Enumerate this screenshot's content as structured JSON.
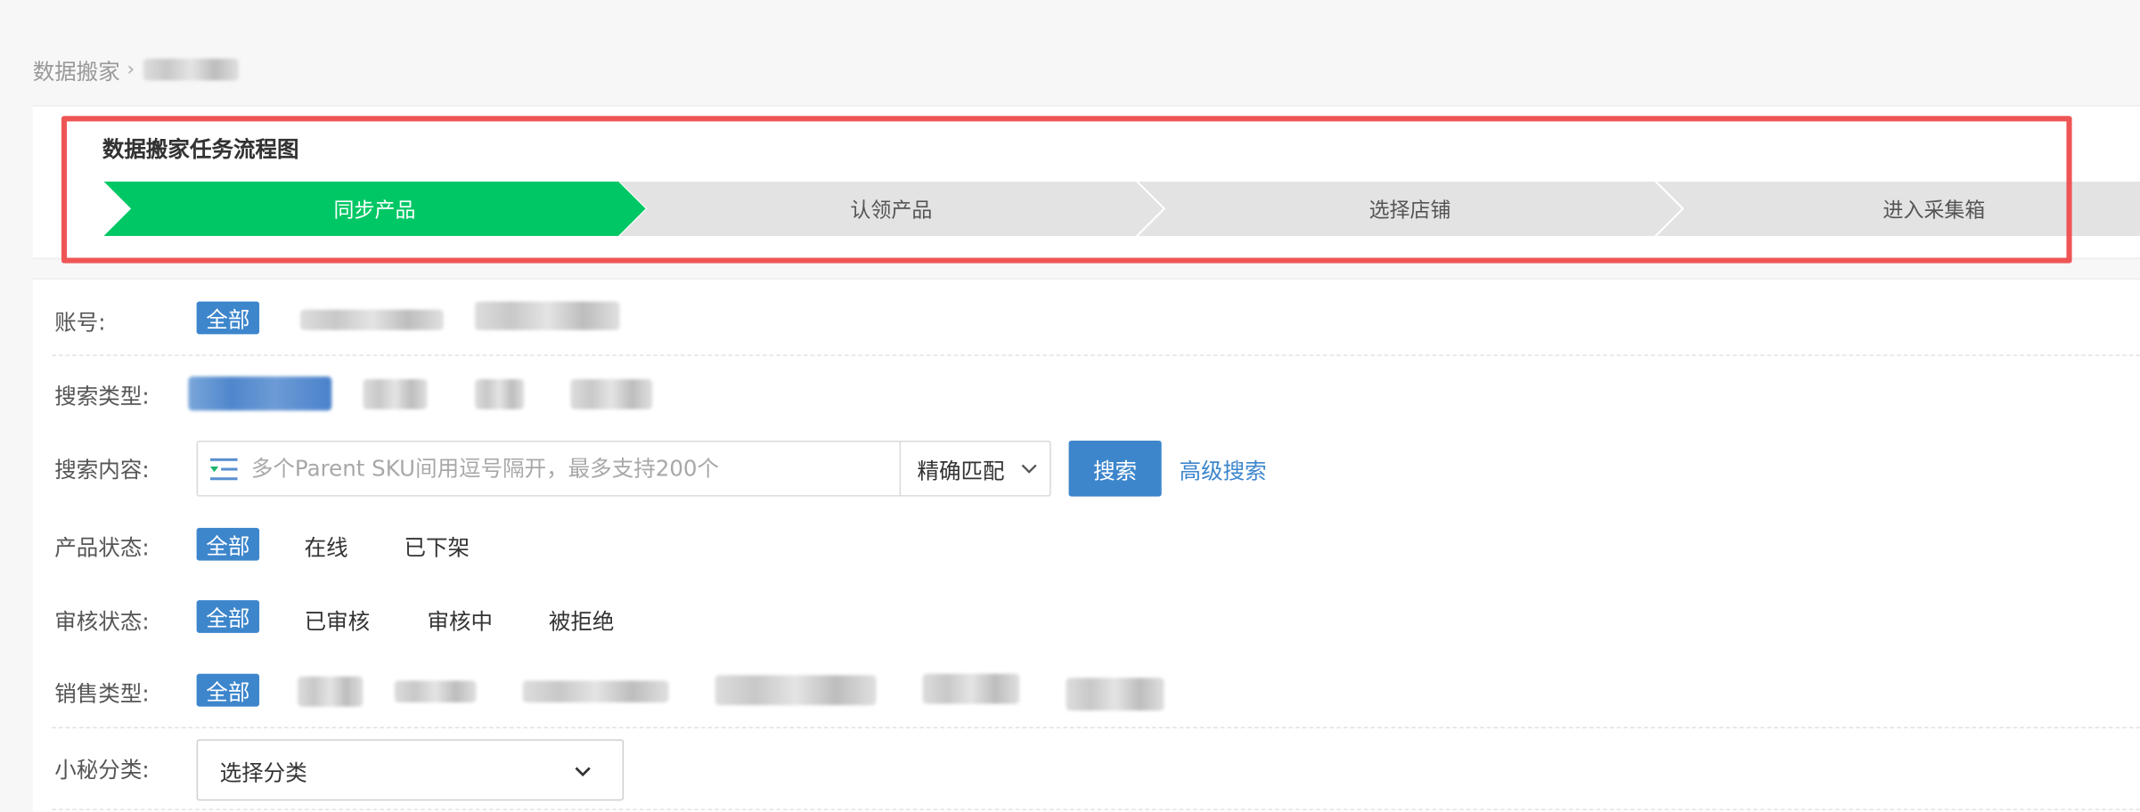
{
  "breadcrumb": {
    "root": "数据搬家",
    "separator": "›"
  },
  "flow": {
    "title": "数据搬家任务流程图",
    "steps": [
      {
        "label": "同步产品",
        "active": true
      },
      {
        "label": "认领产品",
        "active": false
      },
      {
        "label": "选择店铺",
        "active": false
      },
      {
        "label": "进入采集箱",
        "active": false
      }
    ]
  },
  "filters": {
    "account": {
      "label": "账号:",
      "all": "全部"
    },
    "search_type": {
      "label": "搜索类型:"
    },
    "search_content": {
      "label": "搜索内容:",
      "placeholder": "多个Parent SKU间用逗号隔开，最多支持200个",
      "match_mode": "精确匹配",
      "search_button": "搜索",
      "advanced_link": "高级搜索"
    },
    "product_status": {
      "label": "产品状态:",
      "all": "全部",
      "options": [
        "在线",
        "已下架"
      ]
    },
    "review_status": {
      "label": "审核状态:",
      "all": "全部",
      "options": [
        "已审核",
        "审核中",
        "被拒绝"
      ]
    },
    "sales_type": {
      "label": "销售类型:",
      "all": "全部"
    },
    "category": {
      "label": "小秘分类:",
      "placeholder": "选择分类"
    }
  },
  "colors": {
    "primary": "#3d86cc",
    "step_active": "#00c765",
    "step_inactive": "#e3e3e3",
    "annotation": "#ef5555"
  },
  "icons": {
    "search_type_icon": "filter-list-icon",
    "dropdown": "chevron-down-icon",
    "breadcrumb_separator": "chevron-right-icon"
  }
}
